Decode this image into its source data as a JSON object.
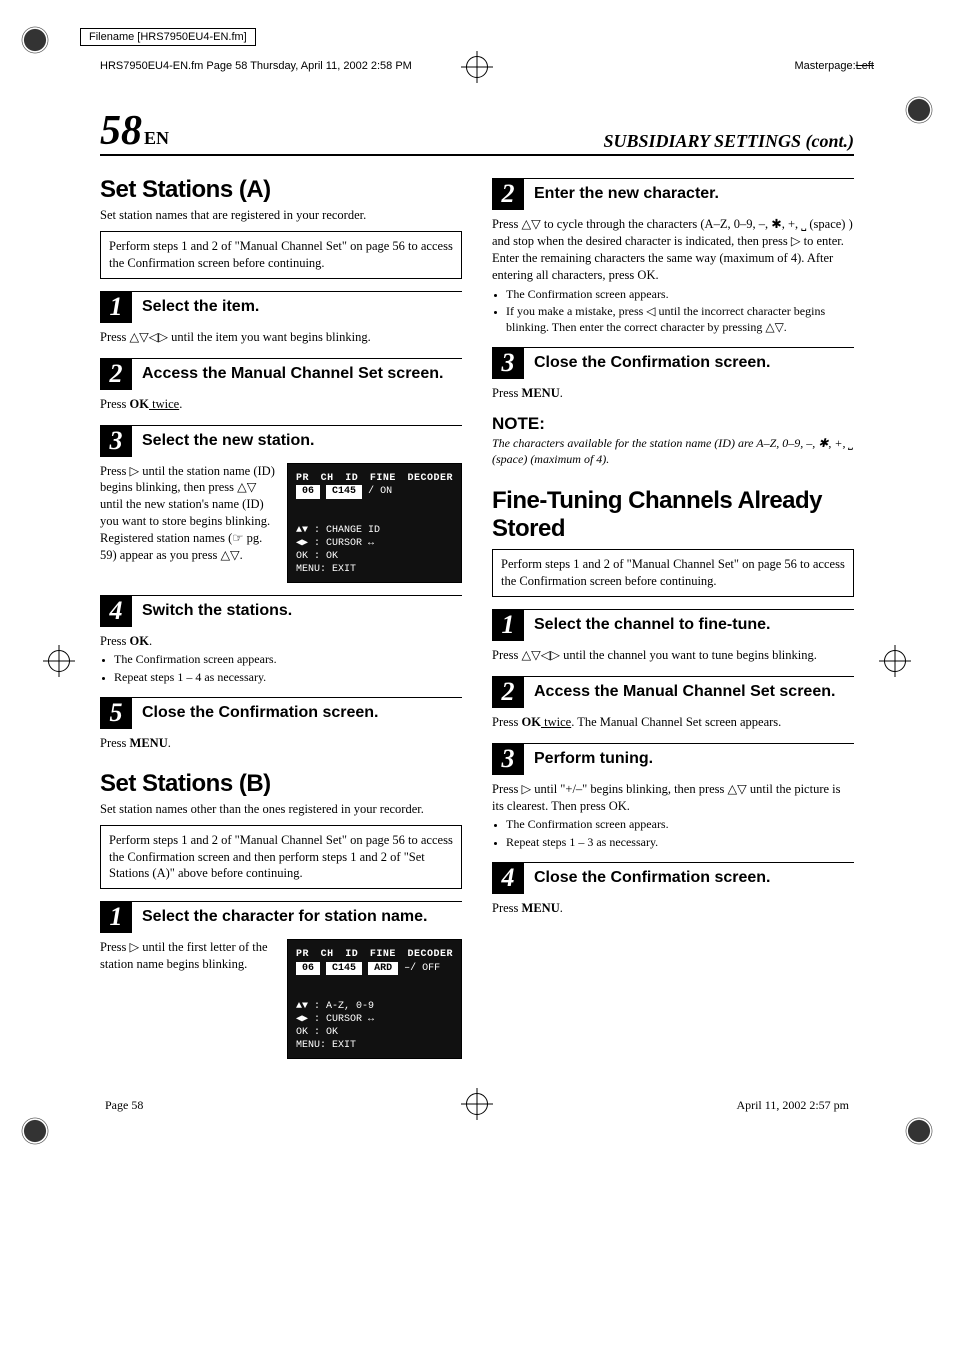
{
  "meta": {
    "filename_label": "Filename [HRS7950EU4-EN.fm]",
    "running_head": "HRS7950EU4-EN.fm  Page 58  Thursday, April 11, 2002  2:58 PM",
    "masterpage_label": "Masterpage:",
    "masterpage_value": "Left",
    "footer_left": "Page 58",
    "footer_right": "April 11, 2002 2:57 pm"
  },
  "header": {
    "page_num": "58",
    "lang": "EN",
    "section": "SUBSIDIARY SETTINGS (cont.)"
  },
  "left": {
    "a_title": "Set Stations (A)",
    "a_sub": "Set station names that are registered in your recorder.",
    "a_box": "Perform steps 1 and 2 of \"Manual Channel Set\" on page 56 to access the Confirmation screen before continuing.",
    "s1_title": "Select the item.",
    "s1_body": "Press △▽◁▷ until the item you want begins blinking.",
    "s2_title": "Access the Manual Channel Set screen.",
    "s2_body_pre": "Press ",
    "s2_ok": "OK",
    "s2_twice": " twice",
    "s2_period": ".",
    "s3_title": "Select the new station.",
    "s3_body": "Press ▷ until the station name (ID) begins blinking, then press △▽ until the new station's name (ID) you want to store begins blinking. Registered station names (☞ pg. 59) appear as you press △▽.",
    "s4_title": "Switch the stations.",
    "s4_body_pre": "Press ",
    "s4_ok": "OK",
    "s4_period": ".",
    "s4_b1": "The Confirmation screen appears.",
    "s4_b2": "Repeat steps 1 – 4 as necessary.",
    "s5_title": "Close the Confirmation screen.",
    "s5_body_pre": "Press ",
    "s5_menu": "MENU",
    "s5_period": ".",
    "b_title": "Set Stations (B)",
    "b_sub": "Set station names other than the ones registered in your recorder.",
    "b_box": "Perform steps 1 and 2 of \"Manual Channel Set\" on page 56 to access the Confirmation screen and then perform steps 1 and 2 of \"Set Stations (A)\" above before continuing.",
    "b_s1_title": "Select the character for station name.",
    "b_s1_body": "Press ▷ until the first letter of the station name begins blinking.",
    "screenA": {
      "hdr": [
        "PR",
        "CH",
        "ID",
        "FINE",
        "DECODER"
      ],
      "row": [
        "06",
        "C145",
        "",
        "/",
        "ON"
      ],
      "leg1": "▲▼  : CHANGE ID",
      "leg2": "◀▶  : CURSOR ↔",
      "leg3": "OK  : OK",
      "leg4": "MENU: EXIT"
    },
    "screenB": {
      "hdr": [
        "PR",
        "CH",
        "ID",
        "FINE",
        "DECODER"
      ],
      "row": [
        "06",
        "C145",
        "ARD",
        "–/",
        "OFF"
      ],
      "leg1": "▲▼  : A-Z, 0-9",
      "leg2": "◀▶  : CURSOR ↔",
      "leg3": "OK  : OK",
      "leg4": "MENU: EXIT"
    }
  },
  "right": {
    "s2_title": "Enter the new character.",
    "s2_body": "Press △▽ to cycle through the characters (A–Z, 0–9, –, ✱, +, ⎵ (space) ) and stop when the desired character is indicated, then press ▷ to enter. Enter the remaining characters the same way (maximum of 4). After entering all characters, press OK.",
    "s2_b1": "The Confirmation screen appears.",
    "s2_b2": "If you make a mistake, press ◁ until the incorrect character begins blinking. Then enter the correct character by pressing △▽.",
    "s3_title": "Close the Confirmation screen.",
    "s3_body_pre": "Press ",
    "s3_menu": "MENU",
    "s3_period": ".",
    "note_h": "NOTE:",
    "note_body": "The characters available for the station name (ID) are A–Z, 0–9, –, ✱, +, ⎵ (space) (maximum of 4).",
    "ft_title": "Fine-Tuning Channels Already Stored",
    "ft_box": "Perform steps 1 and 2 of \"Manual Channel Set\" on page 56 to access the Confirmation screen before continuing.",
    "ft_s1_title": "Select the channel to fine-tune.",
    "ft_s1_body": "Press △▽◁▷ until the channel you want to tune begins blinking.",
    "ft_s2_title": "Access the Manual Channel Set screen.",
    "ft_s2_body_pre": "Press ",
    "ft_s2_ok": "OK",
    "ft_s2_twice": " twice",
    "ft_s2_rest": ". The Manual Channel Set screen appears.",
    "ft_s3_title": "Perform tuning.",
    "ft_s3_body": "Press ▷ until \"+/–\" begins blinking, then press △▽ until the picture is its clearest. Then press OK.",
    "ft_s3_b1": "The Confirmation screen appears.",
    "ft_s3_b2": "Repeat steps 1 – 3 as necessary.",
    "ft_s4_title": "Close the Confirmation screen.",
    "ft_s4_body_pre": "Press ",
    "ft_s4_menu": "MENU",
    "ft_s4_period": "."
  }
}
